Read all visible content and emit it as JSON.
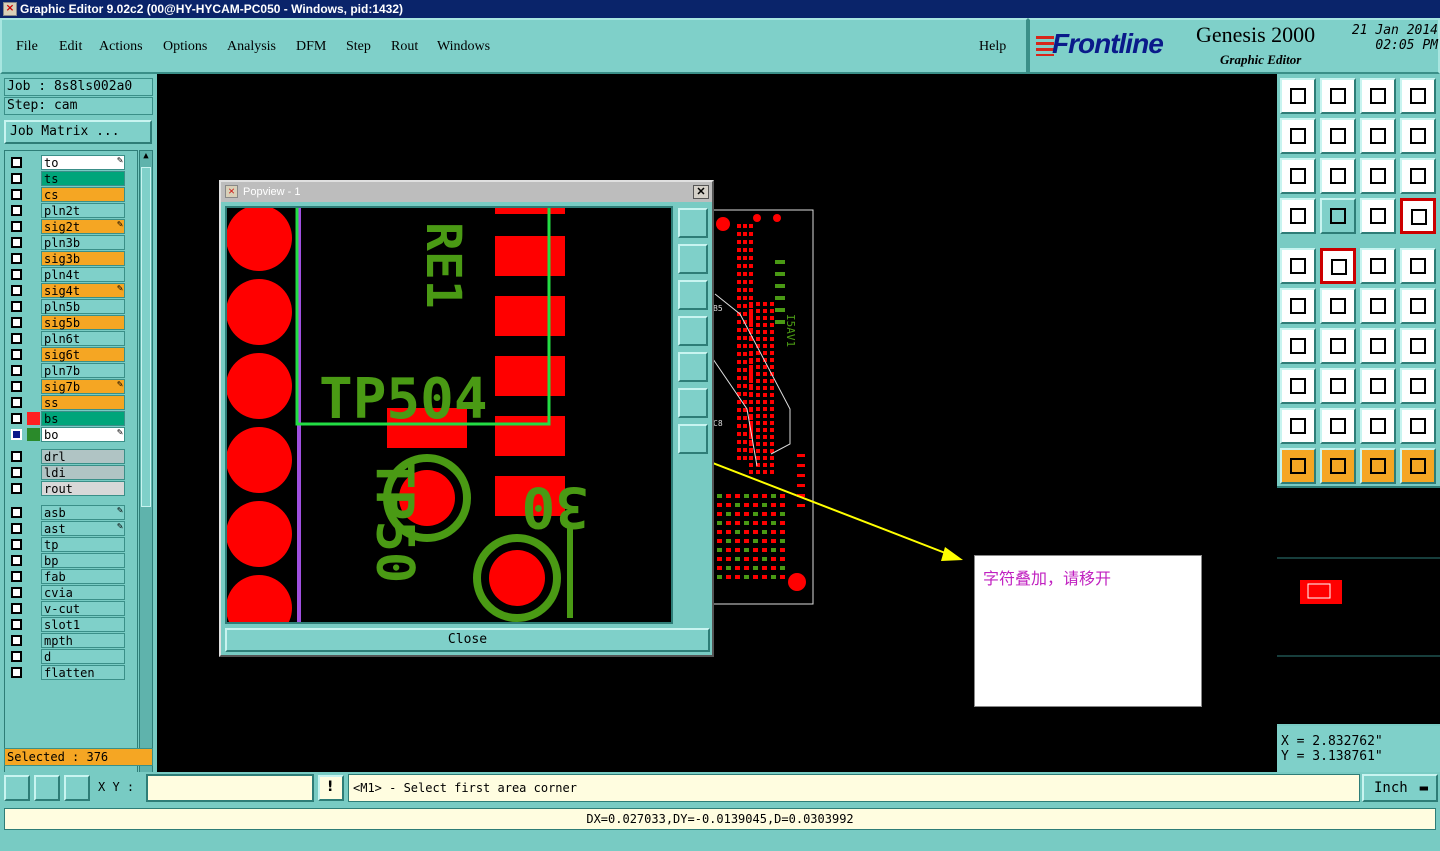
{
  "window": {
    "title": "Graphic Editor 9.02c2 (00@HY-HYCAM-PC050 - Windows, pid:1432)",
    "icon": "app-icon"
  },
  "menu": {
    "items": [
      "File",
      "Edit",
      "Actions",
      "Options",
      "Analysis",
      "DFM",
      "Step",
      "Rout",
      "Windows"
    ],
    "help": "Help"
  },
  "brand": {
    "logo": "Frontline",
    "product": "Genesis 2000",
    "subtitle": "Graphic Editor",
    "date": "21 Jan 2014",
    "time": "02:05 PM",
    "logo_color": "#0a1a8a"
  },
  "job": {
    "job_line": "Job : 8s8ls002a0",
    "step_line": "Step: cam",
    "matrix_button": "Job Matrix ..."
  },
  "layers": [
    {
      "name": "to",
      "color": "#ffffff",
      "mark": "✎"
    },
    {
      "name": "ts",
      "color": "#00a57a",
      "mark": ""
    },
    {
      "name": "cs",
      "color": "#f5a623",
      "mark": ""
    },
    {
      "name": "pln2t",
      "color": "#7fd0c9",
      "mark": ""
    },
    {
      "name": "sig2t",
      "color": "#f5a623",
      "mark": "✎"
    },
    {
      "name": "pln3b",
      "color": "#7fd0c9",
      "mark": ""
    },
    {
      "name": "sig3b",
      "color": "#f5a623",
      "mark": ""
    },
    {
      "name": "pln4t",
      "color": "#7fd0c9",
      "mark": ""
    },
    {
      "name": "sig4t",
      "color": "#f5a623",
      "mark": "✎"
    },
    {
      "name": "pln5b",
      "color": "#7fd0c9",
      "mark": ""
    },
    {
      "name": "sig5b",
      "color": "#f5a623",
      "mark": ""
    },
    {
      "name": "pln6t",
      "color": "#7fd0c9",
      "mark": ""
    },
    {
      "name": "sig6t",
      "color": "#f5a623",
      "mark": ""
    },
    {
      "name": "pln7b",
      "color": "#7fd0c9",
      "mark": ""
    },
    {
      "name": "sig7b",
      "color": "#f5a623",
      "mark": "✎"
    },
    {
      "name": "ss",
      "color": "#f5a623",
      "mark": ""
    },
    {
      "name": "bs",
      "color": "#00a57a",
      "mark": ""
    },
    {
      "name": "bo",
      "color": "#ffffff",
      "mark": "✎"
    },
    {
      "name": "drl",
      "color": "#b0c4c4",
      "mark": ""
    },
    {
      "name": "ldi",
      "color": "#b0c4c4",
      "mark": ""
    },
    {
      "name": "rout",
      "color": "#d8d8d8",
      "mark": ""
    },
    {
      "name": "asb",
      "color": "#7fd0c9",
      "mark": "✎"
    },
    {
      "name": "ast",
      "color": "#7fd0c9",
      "mark": "✎"
    },
    {
      "name": "tp",
      "color": "#7fd0c9",
      "mark": ""
    },
    {
      "name": "bp",
      "color": "#7fd0c9",
      "mark": ""
    },
    {
      "name": "fab",
      "color": "#7fd0c9",
      "mark": ""
    },
    {
      "name": "cvia",
      "color": "#7fd0c9",
      "mark": ""
    },
    {
      "name": "v-cut",
      "color": "#7fd0c9",
      "mark": ""
    },
    {
      "name": "slot1",
      "color": "#7fd0c9",
      "mark": ""
    },
    {
      "name": "mpth",
      "color": "#7fd0c9",
      "mark": ""
    },
    {
      "name": "d",
      "color": "#7fd0c9",
      "mark": ""
    },
    {
      "name": "flatten",
      "color": "#7fd0c9",
      "mark": ""
    }
  ],
  "selected": "Selected : 376",
  "popview": {
    "title": "Popview - 1",
    "close_button": "Close",
    "silkscreen": [
      "RE1",
      "TP504",
      "TP50",
      "30"
    ]
  },
  "board_labels": [
    "I5AV1",
    "C8",
    "B5"
  ],
  "note": {
    "text": "字符叠加，请移开",
    "text_color": "#c020c0"
  },
  "coords": {
    "x": "X = 2.832762\"",
    "y": "Y = 3.138761\""
  },
  "command": {
    "xy_label": "X Y :",
    "xy_value": "",
    "prompt": "<M1> - Select first area corner",
    "unit": "Inch"
  },
  "status": "DX=0.027033,DY=-0.0139045,D=0.0303992",
  "colors": {
    "panel": "#78cbc3",
    "pad_red": "#ff0000",
    "silk_green": "#4a9a14",
    "highlight_green": "#22dd44",
    "arrow_yellow": "#ffff00"
  }
}
